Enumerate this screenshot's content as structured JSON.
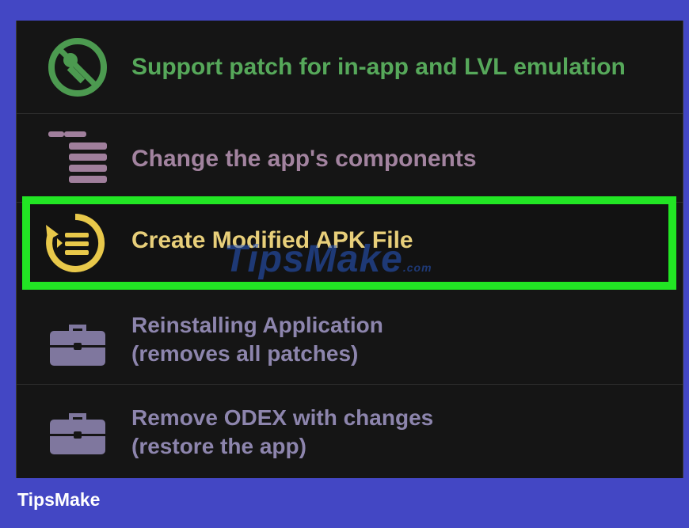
{
  "menu": {
    "items": [
      {
        "label": "Support patch for in-app and LVL emulation",
        "icon": "key-crossed-icon"
      },
      {
        "label": "Change the app's components",
        "icon": "components-list-icon"
      },
      {
        "label": "Create Modified APK File",
        "icon": "create-apk-icon"
      },
      {
        "label": "Reinstalling Application",
        "sublabel": "(removes all patches)",
        "icon": "briefcase-icon"
      },
      {
        "label": "Remove ODEX with changes",
        "sublabel": "(restore the app)",
        "icon": "briefcase-icon"
      }
    ]
  },
  "watermark": {
    "text": "TipsMake",
    "suffix": ".com"
  },
  "footer": {
    "brand": "TipsMake"
  },
  "colors": {
    "background": "#4347c4",
    "panel": "#151515",
    "highlight": "#22e524",
    "green_label": "#56a85a",
    "mauve_label": "#a2839f",
    "yellow_label": "#e8cf7a",
    "purple_label": "#8d85ad"
  }
}
